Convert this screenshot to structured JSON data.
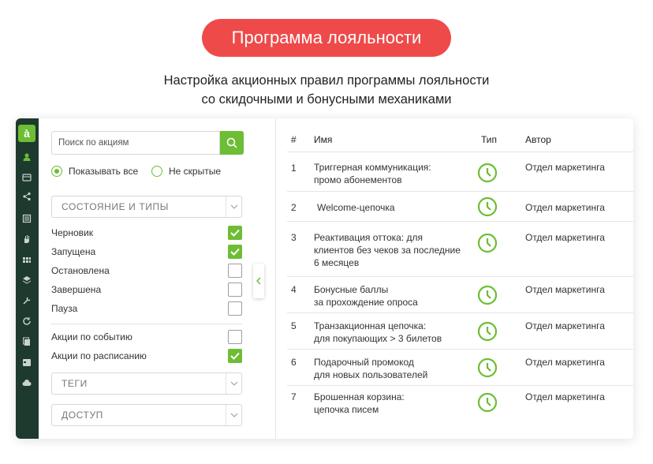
{
  "hero": {
    "title": "Программа лояльности",
    "subtitle_line1": "Настройка акционных правил программы лояльности",
    "subtitle_line2": "со скидочными и бонусными механиками"
  },
  "colors": {
    "accent": "#6dbd35",
    "hero_bg": "#ef4a4a",
    "rail_bg": "#1e3a2e"
  },
  "rail": {
    "logo": "à",
    "icons": [
      "user-icon",
      "card-icon",
      "share-icon",
      "list-icon",
      "hand-icon",
      "grid-icon",
      "layers-icon",
      "tools-icon",
      "refresh-icon",
      "copy-icon",
      "calendar-icon",
      "cloud-icon"
    ]
  },
  "filters": {
    "search_placeholder": "Поиск по акциям",
    "radio_all": "Показывать все",
    "radio_hidden": "Не скрытые",
    "state_select": "СОСТОЯНИЕ И ТИПЫ",
    "states": [
      {
        "label": "Черновик",
        "checked": true
      },
      {
        "label": "Запущена",
        "checked": true
      },
      {
        "label": "Остановлена",
        "checked": false
      },
      {
        "label": "Завершена",
        "checked": false
      },
      {
        "label": "Пауза",
        "checked": false
      }
    ],
    "by_event": {
      "label": "Акции по событию",
      "checked": false
    },
    "by_schedule": {
      "label": "Акции по расписанию",
      "checked": true
    },
    "tags_select": "ТЕГИ",
    "access_select": "ДОСТУП"
  },
  "table": {
    "headers": {
      "num": "#",
      "name": "Имя",
      "type": "Тип",
      "author": "Автор"
    },
    "rows": [
      {
        "num": "1",
        "name1": "Триггерная коммуникация:",
        "name2": "промо абонементов",
        "name3": "",
        "author": "Отдел маркетинга"
      },
      {
        "num": "2",
        "name1": "Welcome-цепочка",
        "name2": "",
        "name3": "",
        "author": "Отдел маркетинга"
      },
      {
        "num": "3",
        "name1": "Реактивация оттока: для",
        "name2": "клиентов без чеков за последние",
        "name3": "6 месяцев",
        "author": "Отдел маркетинга"
      },
      {
        "num": "4",
        "name1": "Бонусные баллы",
        "name2": "за прохождение опроса",
        "name3": "",
        "author": "Отдел маркетинга"
      },
      {
        "num": "5",
        "name1": "Транзакционная цепочка:",
        "name2": "для покупающих > 3 билетов",
        "name3": "",
        "author": "Отдел маркетинга"
      },
      {
        "num": "6",
        "name1": "Подарочный промокод",
        "name2": "для новых пользователей",
        "name3": "",
        "author": "Отдел маркетинга"
      },
      {
        "num": "7",
        "name1": "Брошенная корзина:",
        "name2": "цепочка писем",
        "name3": "",
        "author": "Отдел маркетинга"
      }
    ]
  }
}
